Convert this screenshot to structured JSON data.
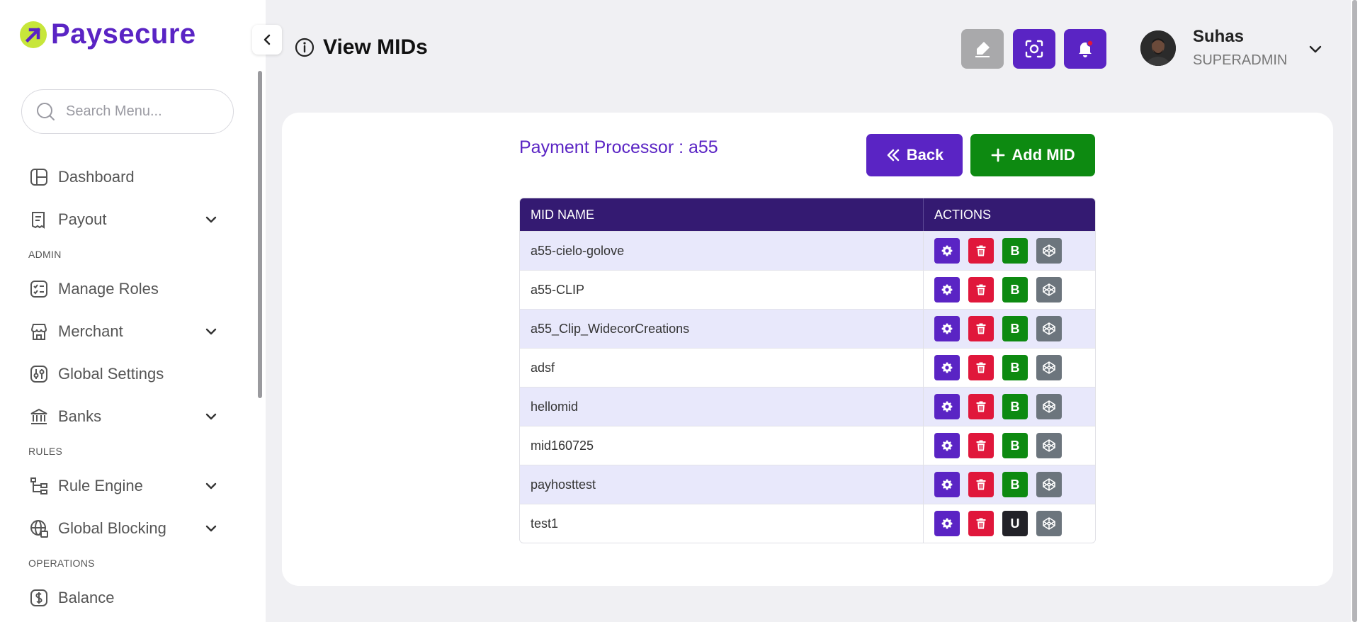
{
  "brand": {
    "name": "Paysecure"
  },
  "sidebar": {
    "search_placeholder": "Search Menu...",
    "items": [
      {
        "type": "item",
        "label": "Dashboard",
        "icon": "dashboard-icon",
        "expandable": false
      },
      {
        "type": "item",
        "label": "Payout",
        "icon": "receipt-icon",
        "expandable": true
      },
      {
        "type": "section",
        "label": "ADMIN"
      },
      {
        "type": "item",
        "label": "Manage Roles",
        "icon": "checklist-icon",
        "expandable": false
      },
      {
        "type": "item",
        "label": "Merchant",
        "icon": "store-icon",
        "expandable": true
      },
      {
        "type": "item",
        "label": "Global Settings",
        "icon": "sliders-icon",
        "expandable": false
      },
      {
        "type": "item",
        "label": "Banks",
        "icon": "bank-icon",
        "expandable": true
      },
      {
        "type": "section",
        "label": "RULES"
      },
      {
        "type": "item",
        "label": "Rule Engine",
        "icon": "hierarchy-icon",
        "expandable": true
      },
      {
        "type": "item",
        "label": "Global Blocking",
        "icon": "globe-block-icon",
        "expandable": true
      },
      {
        "type": "section",
        "label": "OPERATIONS"
      },
      {
        "type": "item",
        "label": "Balance",
        "icon": "dollar-icon",
        "expandable": false
      }
    ]
  },
  "header": {
    "title": "View MIDs",
    "buttons": [
      {
        "name": "clear-cache-icon",
        "color": "#a9a9ab"
      },
      {
        "name": "screenshot-icon",
        "color": "#5a24c4"
      },
      {
        "name": "notification-bell-icon",
        "color": "#5a24c4"
      }
    ],
    "user": {
      "name": "Suhas",
      "role": "SUPERADMIN"
    }
  },
  "main": {
    "processor_label": "Payment Processor : a55",
    "back_label": "Back",
    "add_label": "Add MID",
    "table": {
      "headers": [
        "MID NAME",
        "ACTIONS"
      ],
      "rows": [
        {
          "name": "a55-cielo-golove",
          "status": "B"
        },
        {
          "name": "a55-CLIP",
          "status": "B"
        },
        {
          "name": "a55_Clip_WidecorCreations",
          "status": "B"
        },
        {
          "name": "adsf",
          "status": "B"
        },
        {
          "name": "hellomid",
          "status": "B"
        },
        {
          "name": "mid160725",
          "status": "B"
        },
        {
          "name": "payhosttest",
          "status": "B"
        },
        {
          "name": "test1",
          "status": "U"
        }
      ]
    }
  },
  "colors": {
    "brand_purple": "#5a24c4",
    "table_header": "#341a72",
    "success_green": "#0d8a11",
    "danger_red": "#e0173b"
  }
}
